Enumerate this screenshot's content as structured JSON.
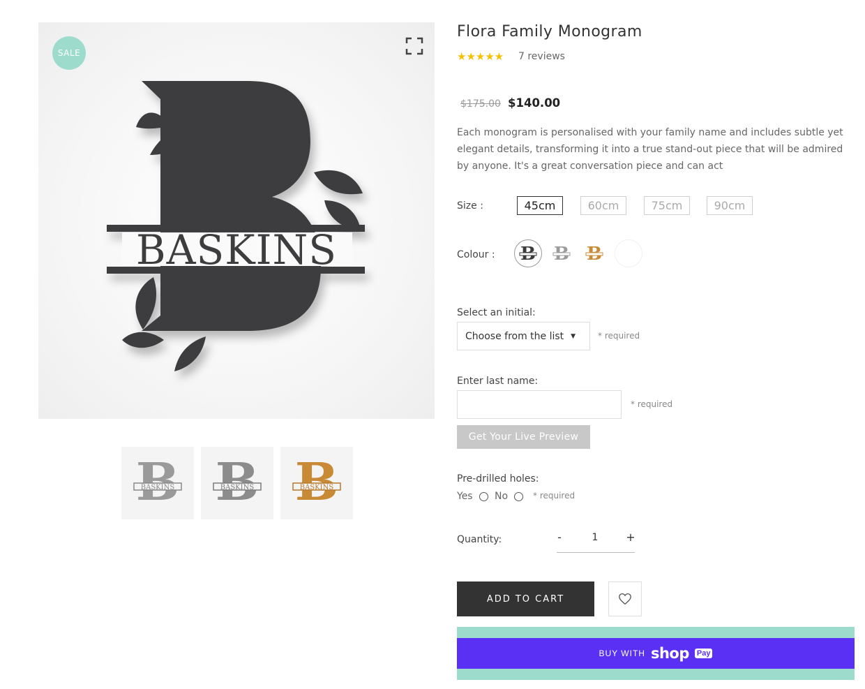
{
  "product": {
    "title": "Flora Family Monogram",
    "sale_badge": "SALE",
    "rating_stars": "★★★★★",
    "rating": 5,
    "reviews": "7 reviews",
    "old_price": "$175.00",
    "price": "$140.00",
    "description": "Each monogram is personalised with your family name and includes subtle yet elegant details, transforming it into a true stand-out piece that will be admired by anyone. It's a great conversation piece and can act",
    "image_monogram_text": "BASKINS",
    "image_letter": "B"
  },
  "options": {
    "size_label": "Size :",
    "sizes": [
      "45cm",
      "60cm",
      "75cm",
      "90cm"
    ],
    "selected_size": "45cm",
    "colour_label": "Colour :",
    "colours": [
      {
        "name": "dark",
        "hex": "#3b3b3b"
      },
      {
        "name": "silver",
        "hex": "#9b9b9b"
      },
      {
        "name": "gold",
        "hex": "#c98a35"
      },
      {
        "name": "white",
        "hex": "#ffffff"
      }
    ]
  },
  "personalise": {
    "initial_label": "Select an initial:",
    "initial_value": "Choose from the list",
    "required": "* required",
    "lastname_label": "Enter last name:",
    "lastname_value": "",
    "preview_button": "Get Your Live Preview",
    "holes_label": "Pre-drilled holes:",
    "yes": "Yes",
    "no": "No"
  },
  "quantity": {
    "label": "Quantity:",
    "minus": "-",
    "plus": "+",
    "value": "1"
  },
  "actions": {
    "add_to_cart": "ADD TO CART",
    "buy_with": "BUY WITH",
    "shop": "shop",
    "pay": "Pay"
  },
  "colors": {
    "sale_badge": "#9ddccd",
    "shop_pay": "#5a31f4",
    "cart_button": "#333333",
    "stars": "#f4c000"
  }
}
